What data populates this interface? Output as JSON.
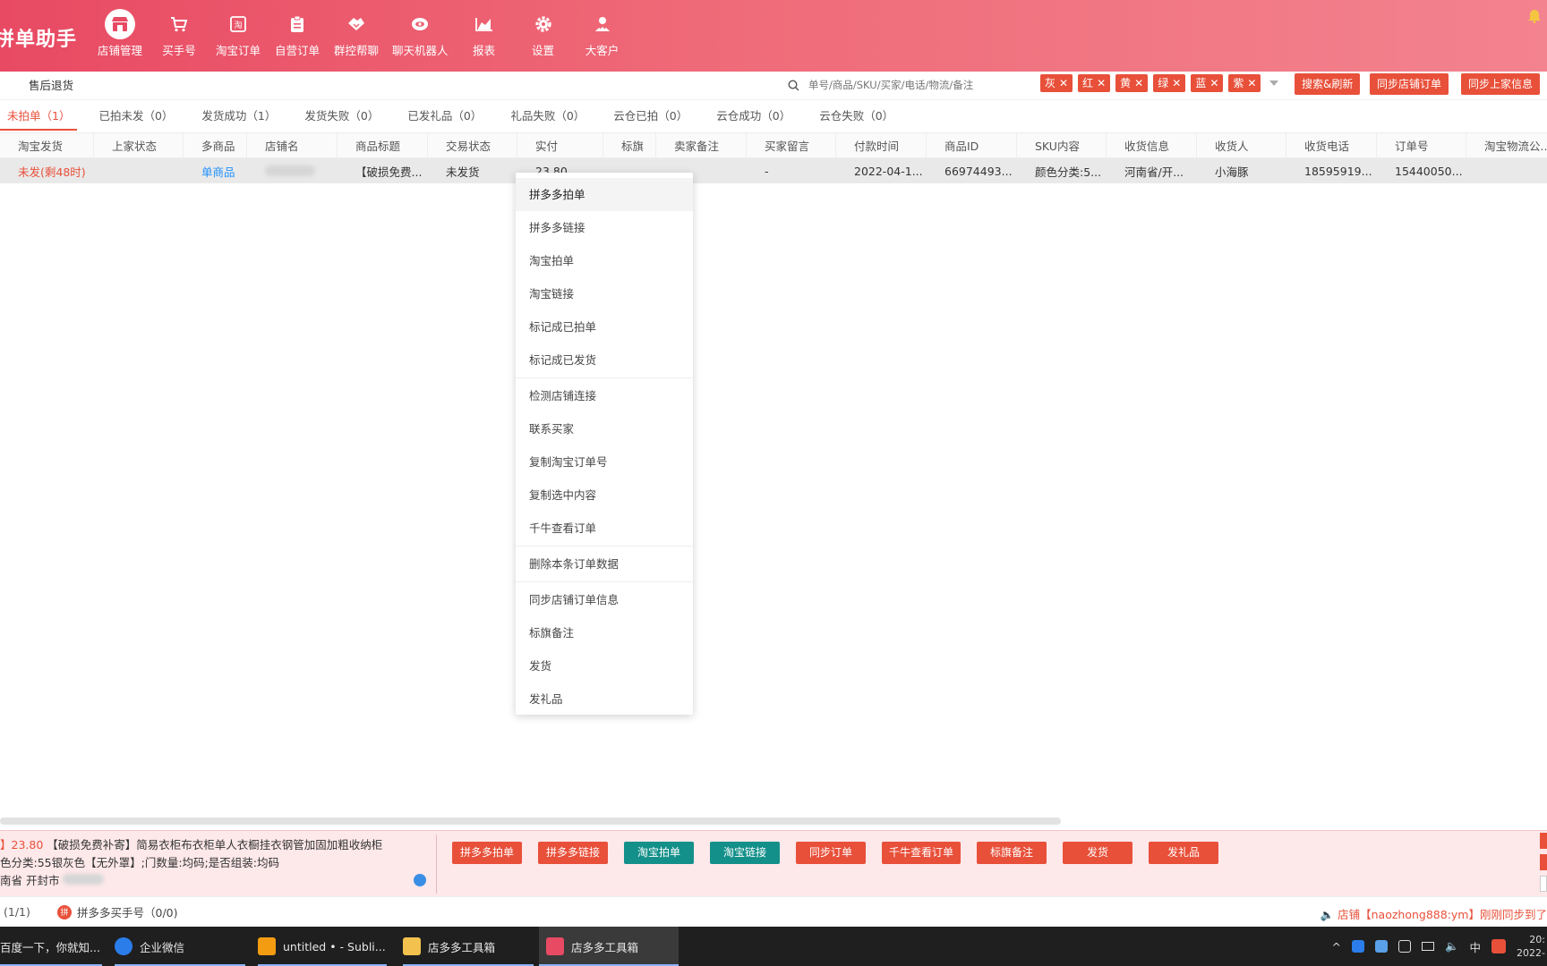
{
  "app": {
    "title": "拼单助手"
  },
  "nav": [
    {
      "label": "店铺管理",
      "icon": "store-icon",
      "active": true
    },
    {
      "label": "买手号",
      "icon": "cart-icon"
    },
    {
      "label": "淘宝订单",
      "icon": "taobao-icon"
    },
    {
      "label": "自营订单",
      "icon": "clipboard-icon"
    },
    {
      "label": "群控帮聊",
      "icon": "handshake-icon"
    },
    {
      "label": "聊天机器人",
      "icon": "robot-eye-icon"
    },
    {
      "label": "报表",
      "icon": "chart-icon"
    },
    {
      "label": "设置",
      "icon": "gear-icon"
    },
    {
      "label": "大客户",
      "icon": "vip-user-icon"
    }
  ],
  "toolbar": {
    "aftersale": "售后退货",
    "search_placeholder": "单号/商品/SKU/买家/电话/物流/备注",
    "tags": [
      "灰",
      "红",
      "黄",
      "绿",
      "蓝",
      "紫"
    ],
    "search_refresh": "搜索&刷新",
    "sync_shop": "同步店铺订单",
    "sync_seller": "同步上家信息"
  },
  "tabs": [
    {
      "label": "未拍单（1）",
      "active": true
    },
    {
      "label": "已拍未发（0）"
    },
    {
      "label": "发货成功（1）"
    },
    {
      "label": "发货失败（0）"
    },
    {
      "label": "已发礼品（0）"
    },
    {
      "label": "礼品失败（0）"
    },
    {
      "label": "云仓已拍（0）"
    },
    {
      "label": "云仓成功（0）"
    },
    {
      "label": "云仓失败（0）"
    }
  ],
  "table": {
    "columns": [
      "淘宝发货",
      "上家状态",
      "多商品",
      "店铺名",
      "商品标题",
      "交易状态",
      "实付",
      "标旗",
      "卖家备注",
      "买家留言",
      "付款时间",
      "商品ID",
      "SKU内容",
      "收货信息",
      "收货人",
      "收货电话",
      "订单号",
      "淘宝物流公..."
    ],
    "row": {
      "taobao_ship": "未发(剩48时)",
      "seller_status": "",
      "multi": "单商品",
      "title": "【破损免费...",
      "trade_status": "未发货",
      "paid": "23.80",
      "flag": "",
      "seller_note": "",
      "buyer_msg": "-",
      "pay_time": "2022-04-1...",
      "product_id": "66974493...",
      "sku": "颜色分类:5...",
      "address": "河南省/开...",
      "receiver": "小海豚",
      "phone": "18595919...",
      "order_no": "15440050...",
      "logistics": ""
    }
  },
  "context_menu": {
    "groups": [
      [
        "拼多多拍单",
        "拼多多链接",
        "淘宝拍单",
        "淘宝链接",
        "标记成已拍单",
        "标记成已发货"
      ],
      [
        "检测店铺连接",
        "联系买家",
        "复制淘宝订单号",
        "复制选中内容",
        "千牛查看订单"
      ],
      [
        "删除本条订单数据"
      ],
      [
        "同步店铺订单信息",
        "标旗备注",
        "发货",
        "发礼品"
      ]
    ]
  },
  "detail": {
    "price": "23.80",
    "title": "【破损免费补寄】简易衣柜布衣柜单人衣橱挂衣钢管加固加粗收纳柜",
    "sku_line": "色分类:55银灰色【无外罩】;门数量:均码;是否组装:均码",
    "addr_line": "南省 开封市"
  },
  "actions": [
    {
      "label": "拼多多拍单",
      "color": "#e8503a"
    },
    {
      "label": "拼多多链接",
      "color": "#e8503a"
    },
    {
      "label": "淘宝拍单",
      "color": "#14908a"
    },
    {
      "label": "淘宝链接",
      "color": "#14908a"
    },
    {
      "label": "同步订单",
      "color": "#e8503a"
    },
    {
      "label": "千牛查看订单",
      "color": "#e8503a"
    },
    {
      "label": "标旗备注",
      "color": "#e8503a"
    },
    {
      "label": "发货",
      "color": "#e8503a"
    },
    {
      "label": "发礼品",
      "color": "#e8503a"
    }
  ],
  "statusbar": {
    "left": "(1/1)",
    "pdd_accounts": "拼多多买手号（0/0)",
    "right": "店铺【naozhong888:ym】刚刚同步到了"
  },
  "taskbar": {
    "items": [
      "百度一下，你就知...",
      "企业微信",
      "untitled • - Subli...",
      "店多多工具箱",
      "店多多工具箱"
    ],
    "ime": "中",
    "time": "20:",
    "date": "2022-"
  },
  "colors": {
    "accent": "#e8503a",
    "teal": "#14908a",
    "header_start": "#e84a63",
    "header_end": "#f3838f"
  }
}
